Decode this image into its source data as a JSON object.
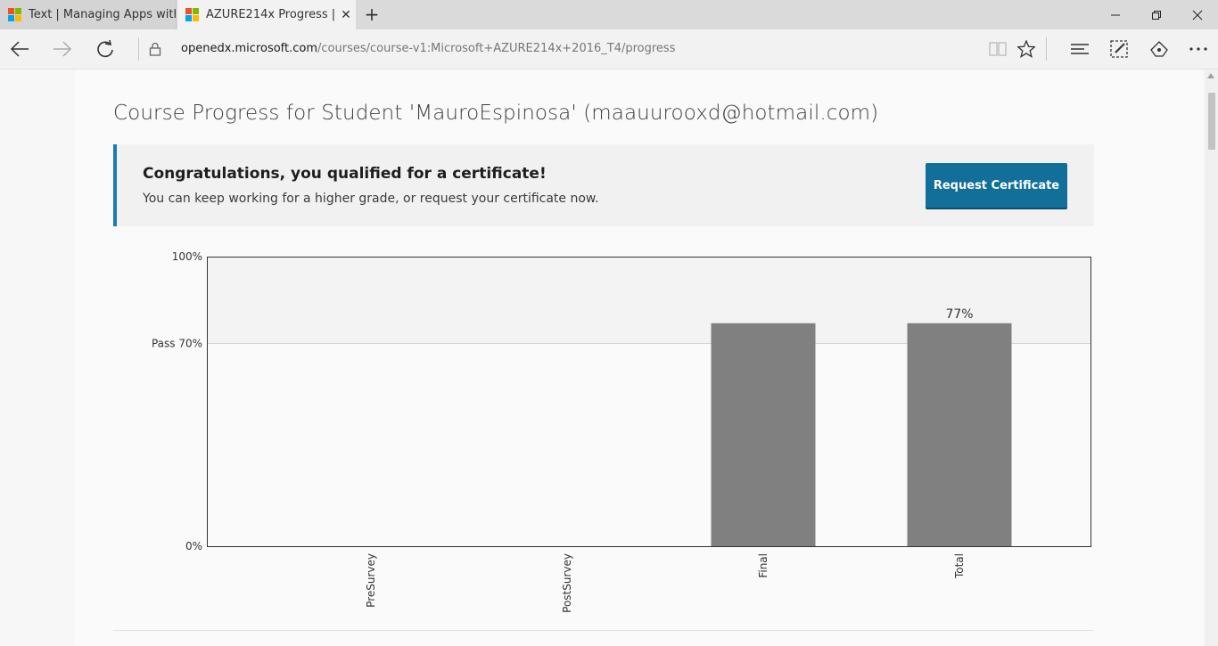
{
  "browser": {
    "tabs": [
      {
        "title": "Text | Managing Apps with A",
        "active": false
      },
      {
        "title": "AZURE214x Progress | M",
        "active": true
      }
    ],
    "url_domain": "openedx.microsoft.com",
    "url_prefix": "",
    "url_path": "/courses/course-v1:Microsoft+AZURE214x+2016_T4/progress"
  },
  "page": {
    "title": "Course Progress for Student 'MauroEspinosa' (maauurooxd@hotmail.com)",
    "certificate": {
      "heading": "Congratulations, you qualified for a certificate!",
      "message": "You can keep working for a higher grade, or request your certificate now.",
      "button_label": "Request Certificate"
    }
  },
  "colors": {
    "accent": "#1a7bb4",
    "button": "#126f9a",
    "bar": "#808080"
  },
  "chart_data": {
    "type": "bar",
    "categories": [
      "PreSurvey",
      "PostSurvey",
      "Final",
      "Total"
    ],
    "values": [
      0,
      0,
      77,
      77
    ],
    "ylim": [
      0,
      100
    ],
    "y_ticks": [
      {
        "value": 100,
        "label": "100%"
      },
      {
        "value": 70,
        "label": "Pass 70%"
      },
      {
        "value": 0,
        "label": "0%"
      }
    ],
    "data_labels": [
      null,
      null,
      null,
      "77%"
    ],
    "pass_threshold": 70
  }
}
